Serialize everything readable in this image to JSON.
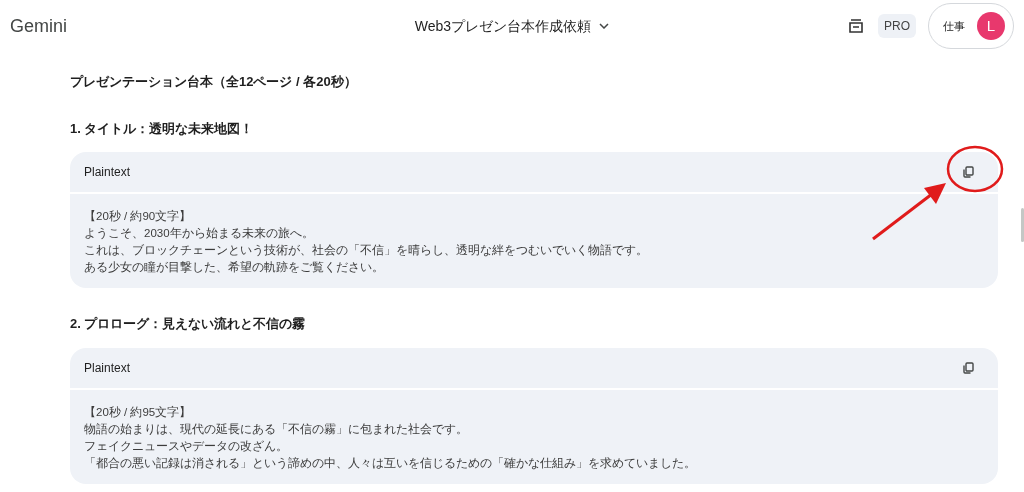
{
  "header": {
    "logo": "Gemini",
    "chat_title": "Web3プレゼン台本作成依頼",
    "plan_badge": "PRO",
    "workspace": "仕事",
    "avatar_letter": "L"
  },
  "document_title": "プレゼンテーション台本（全12ページ / 各20秒）",
  "sections": [
    {
      "heading": "1. タイトル：透明な未来地図！",
      "code_block": {
        "language": "Plaintext",
        "highlighted_copy": true,
        "lines": [
          "【20秒 / 約90文字】",
          "ようこそ、2030年から始まる未来の旅へ。",
          "これは、ブロックチェーンという技術が、社会の「不信」を晴らし、透明な絆をつむいでいく物語です。",
          "ある少女の瞳が目撃した、希望の軌跡をご覧ください。"
        ]
      }
    },
    {
      "heading": "2. プロローグ：見えない流れと不信の霧",
      "code_block": {
        "language": "Plaintext",
        "highlighted_copy": false,
        "lines": [
          "【20秒 / 約95文字】",
          "物語の始まりは、現代の延長にある「不信の霧」に包まれた社会です。",
          "フェイクニュースやデータの改ざん。",
          "「都合の悪い記録は消される」という諦めの中、人々は互いを信じるための「確かな仕組み」を求めていました。"
        ]
      }
    }
  ]
}
